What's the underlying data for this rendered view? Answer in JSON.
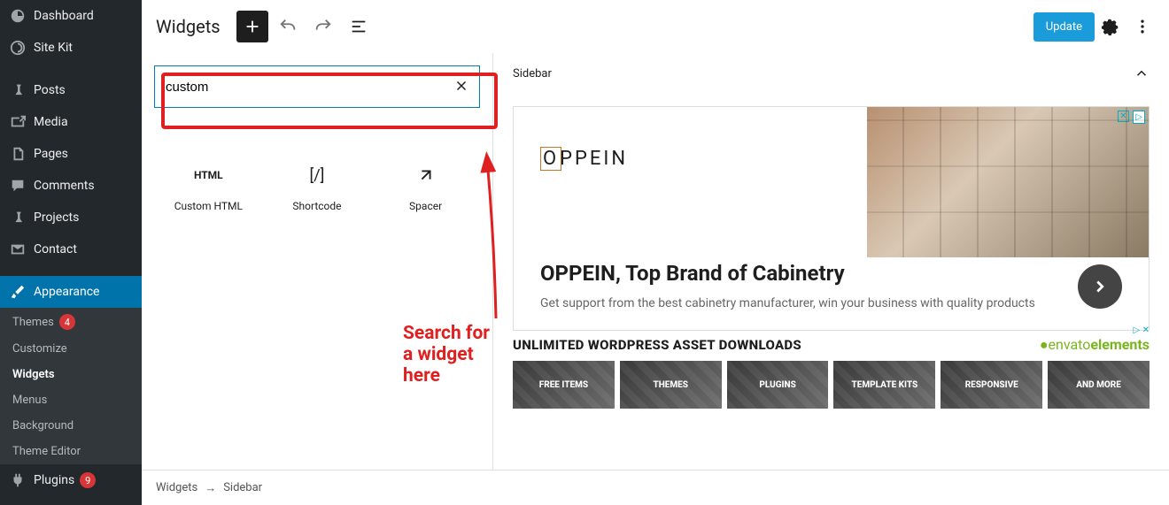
{
  "sidebar": {
    "items": [
      {
        "label": "Dashboard",
        "icon": "dashboard"
      },
      {
        "label": "Site Kit",
        "icon": "sitekit"
      },
      {
        "label": "Posts",
        "icon": "pin"
      },
      {
        "label": "Media",
        "icon": "media"
      },
      {
        "label": "Pages",
        "icon": "pages"
      },
      {
        "label": "Comments",
        "icon": "comments"
      },
      {
        "label": "Projects",
        "icon": "pin"
      },
      {
        "label": "Contact",
        "icon": "mail"
      },
      {
        "label": "Appearance",
        "icon": "brush",
        "active": true
      },
      {
        "label": "Plugins",
        "icon": "plug",
        "badge": "9"
      }
    ],
    "submenu": [
      {
        "label": "Themes",
        "badge": "4"
      },
      {
        "label": "Customize"
      },
      {
        "label": "Widgets",
        "current": true
      },
      {
        "label": "Menus"
      },
      {
        "label": "Background"
      },
      {
        "label": "Theme Editor"
      }
    ]
  },
  "toolbar": {
    "title": "Widgets",
    "update_label": "Update"
  },
  "inserter": {
    "search_value": "custom",
    "blocks": [
      {
        "label": "Custom HTML",
        "icon_text": "HTML"
      },
      {
        "label": "Shortcode",
        "icon_text": "[/]"
      },
      {
        "label": "Spacer",
        "icon_text": "expand"
      }
    ]
  },
  "annotation": {
    "text": "Search for a widget here"
  },
  "preview": {
    "panel_title": "Sidebar",
    "ad": {
      "logo": "OPPEIN",
      "title": "OPPEIN, Top Brand of Cabinetry",
      "desc": "Get support from the best cabinetry manufacturer, win your business with quality products",
      "badge": "▷✕"
    },
    "envato": {
      "headline": "UNLIMITED WORDPRESS ASSET DOWNLOADS",
      "brand": "envatoelements"
    },
    "tiles": [
      "FREE ITEMS",
      "THEMES",
      "PLUGINS",
      "TEMPLATE KITS",
      "RESPONSIVE",
      "AND MORE"
    ]
  },
  "breadcrumb": {
    "a": "Widgets",
    "b": "Sidebar"
  }
}
